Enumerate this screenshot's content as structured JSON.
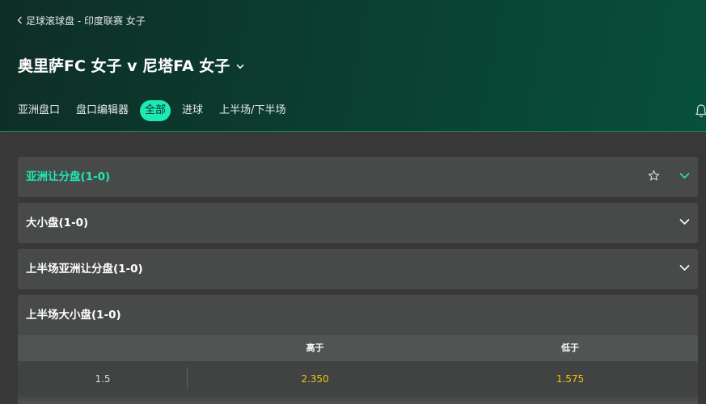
{
  "breadcrumb": {
    "label": "足球滚球盘 - 印度联赛 女子"
  },
  "match": {
    "title": "奥里萨FC 女子 v 尼塔FA 女子"
  },
  "tabs": [
    {
      "label": "亚洲盘口"
    },
    {
      "label": "盘口编辑器"
    },
    {
      "label": "全部",
      "active": true
    },
    {
      "label": "进球"
    },
    {
      "label": "上半场/下半场"
    }
  ],
  "markets": [
    {
      "title": "亚洲让分盘(1-0)",
      "highlighted": true,
      "favorite_icon": "star-icon",
      "expand_icon": "chevron-down-icon"
    },
    {
      "title": "大小盘(1-0)",
      "expand_icon": "chevron-down-icon"
    },
    {
      "title": "上半场亚洲让分盘(1-0)",
      "expand_icon": "chevron-down-icon"
    }
  ],
  "expanded_market": {
    "title": "上半场大小盘(1-0)",
    "columns": [
      "高于",
      "低于"
    ],
    "rows": [
      {
        "line": "1.5",
        "over": "2.350",
        "under": "1.575"
      }
    ]
  },
  "colors": {
    "accent": "#1de9b6",
    "odds": "#f4c20d",
    "header_gradient_end": "#07503a",
    "background": "#383838"
  }
}
